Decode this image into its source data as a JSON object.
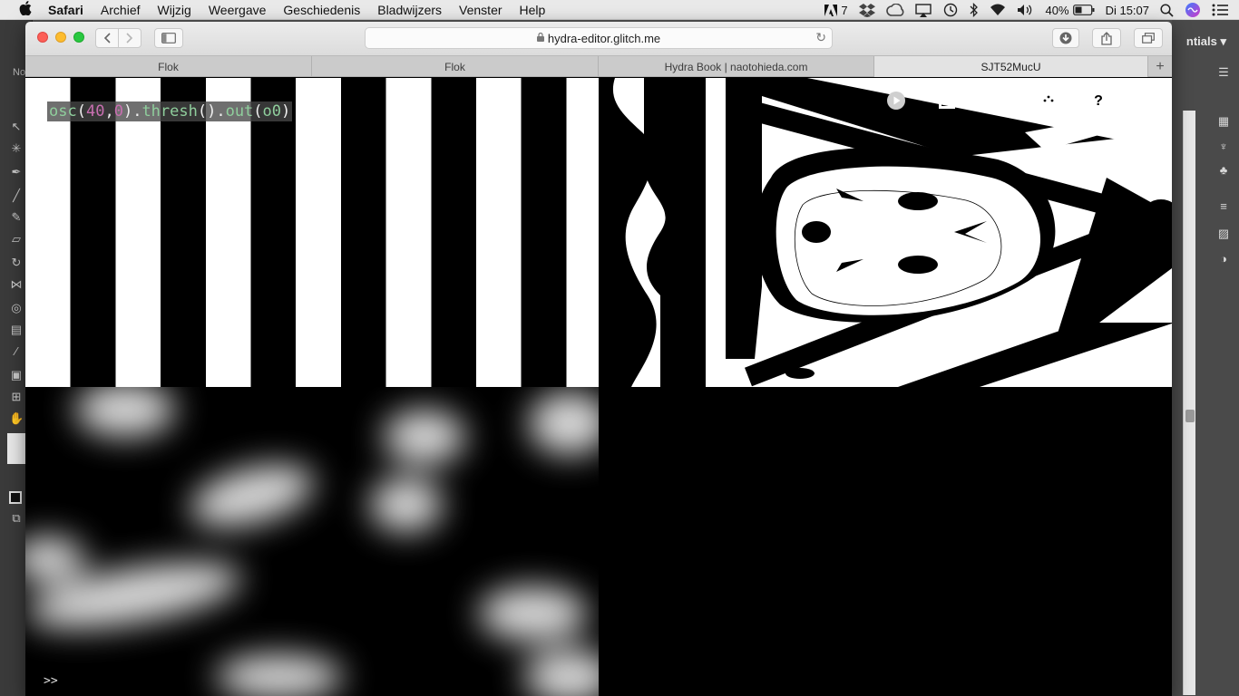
{
  "menubar": {
    "app_name": "Safari",
    "items": [
      "Archief",
      "Wijzig",
      "Weergave",
      "Geschiedenis",
      "Bladwijzers",
      "Venster",
      "Help"
    ],
    "status": {
      "adobe_count": "7",
      "battery": "40%",
      "clock": "Di 15:07"
    }
  },
  "background_app": {
    "workspace_label": "ntials",
    "toolbar_label": "No"
  },
  "window": {
    "url": "hydra-editor.glitch.me",
    "tabs": [
      {
        "label": "Flok"
      },
      {
        "label": "Flok"
      },
      {
        "label": "Hydra Book | naotohieda.com"
      },
      {
        "label": "SJT52MucU"
      }
    ],
    "new_tab_label": "+"
  },
  "editor": {
    "code_tokens": {
      "t1": "osc",
      "t2": "(",
      "t3": "40",
      "t4": ",",
      "t5": "0",
      "t6": ").",
      "t7": "thresh",
      "t8": "().",
      "t9": "out",
      "t10": "(",
      "t11": "o0",
      "t12": ")"
    },
    "console_prompt": ">>"
  },
  "icons": {
    "run": "play-icon",
    "upload": "upload-icon",
    "clear": "trash-icon",
    "random": "dice-icon",
    "help": "help-icon"
  },
  "colors": {
    "code_fn": "#8fce9c",
    "code_num": "#c86fb0",
    "code_bg": "#464646"
  }
}
